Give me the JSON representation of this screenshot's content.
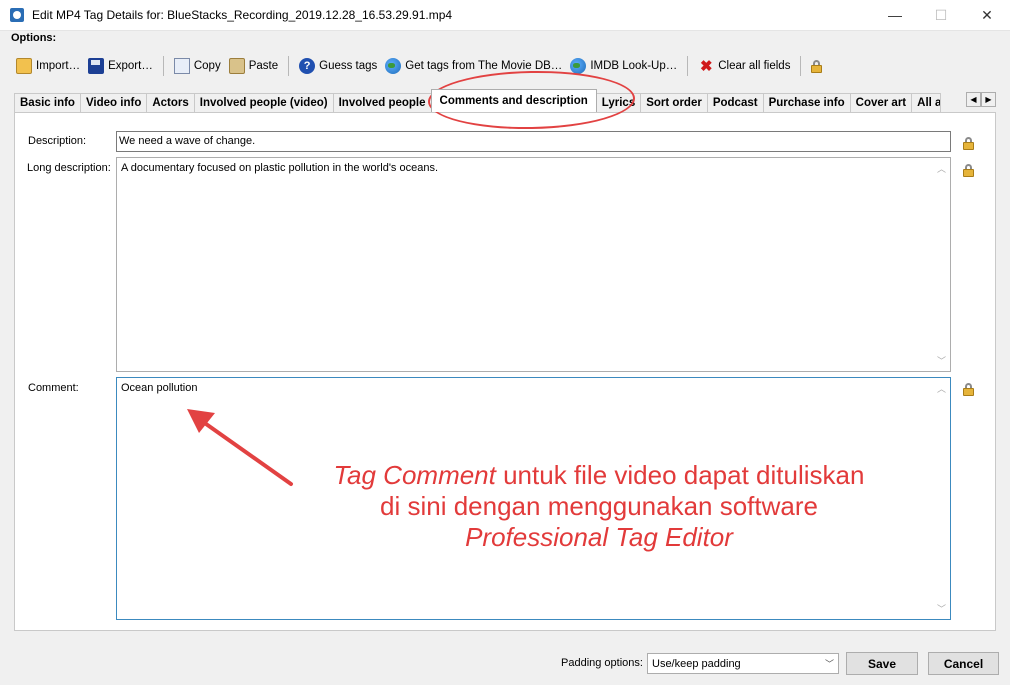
{
  "window": {
    "title": "Edit MP4 Tag Details for: BlueStacks_Recording_2019.12.28_16.53.29.91.mp4",
    "minimize": "—",
    "maximize": "☐",
    "close": "✕"
  },
  "options_label": "Options:",
  "toolbar": {
    "import": "Import…",
    "export": "Export…",
    "copy": "Copy",
    "paste": "Paste",
    "guess": "Guess tags",
    "moviedb": "Get tags from The Movie DB…",
    "imdb": "IMDB Look-Up…",
    "clear": "Clear all fields"
  },
  "tabs": [
    {
      "label": "Basic info"
    },
    {
      "label": "Video info"
    },
    {
      "label": "Actors"
    },
    {
      "label": "Involved people (video)"
    },
    {
      "label": "Involved people"
    },
    {
      "label": "Comments and description"
    },
    {
      "label": "Lyrics"
    },
    {
      "label": "Sort order"
    },
    {
      "label": "Podcast"
    },
    {
      "label": "Purchase info"
    },
    {
      "label": "Cover art"
    },
    {
      "label": "All a"
    }
  ],
  "active_tab_index": 5,
  "fields": {
    "description_label": "Description:",
    "description_value": "We need a wave of change.",
    "long_description_label": "Long description:",
    "long_description_value": "A documentary focused on plastic pollution in the world's oceans.",
    "comment_label": "Comment:",
    "comment_value": "Ocean pollution"
  },
  "annotation": {
    "line1_italic": "Tag Comment",
    "line1_rest": " untuk file video dapat dituliskan",
    "line2": "di sini dengan menggunakan software",
    "line3_italic": "Professional Tag Editor",
    "color": "#e23a3a"
  },
  "bottom": {
    "padding_label": "Padding options:",
    "padding_value": "Use/keep padding",
    "save": "Save",
    "cancel": "Cancel"
  }
}
